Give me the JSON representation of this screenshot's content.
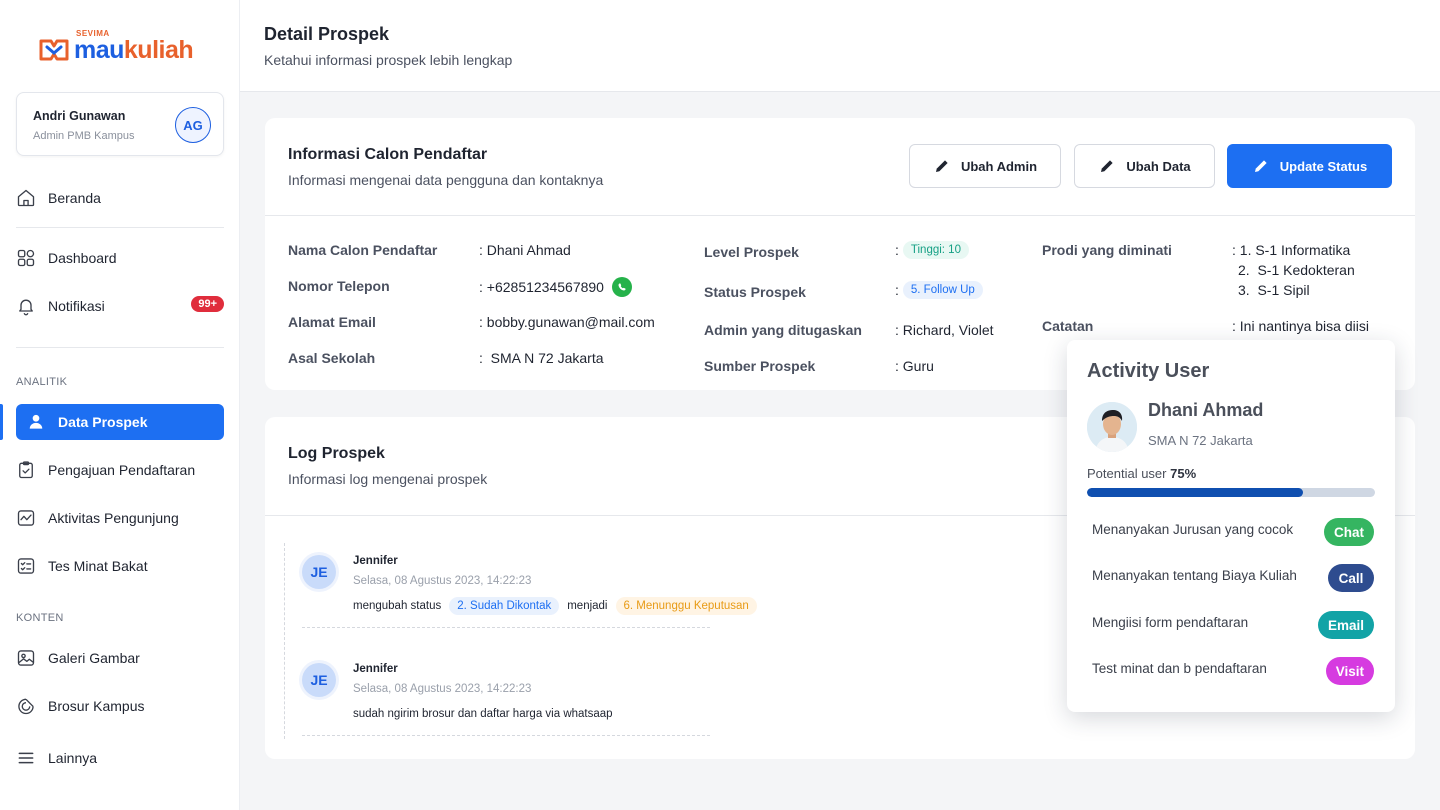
{
  "brand": {
    "small": "SEVIMA",
    "mau": "mau",
    "kuliah": "kuliah"
  },
  "user": {
    "name": "Andri Gunawan",
    "role": "Admin PMB Kampus",
    "initials": "AG"
  },
  "nav": {
    "beranda": "Beranda",
    "dashboard": "Dashboard",
    "notifikasi": "Notifikasi",
    "notif_badge": "99+",
    "section_analitik": "ANALITIK",
    "data_prospek": "Data Prospek",
    "pengajuan": "Pengajuan Pendaftaran",
    "aktivitas": "Aktivitas Pengunjung",
    "tes_minat": "Tes Minat Bakat",
    "section_konten": "KONTEN",
    "galeri": "Galeri Gambar",
    "brosur": "Brosur Kampus",
    "lainnya": "Lainnya"
  },
  "header": {
    "title": "Detail Prospek",
    "subtitle": "Ketahui informasi prospek lebih lengkap"
  },
  "info": {
    "title": "Informasi Calon Pendaftar",
    "subtitle": "Informasi mengenai data pengguna dan kontaknya",
    "btn_ubah_admin": "Ubah Admin",
    "btn_ubah_data": "Ubah Data",
    "btn_update_status": "Update Status",
    "nama_label": "Nama Calon Pendaftar",
    "nama_value": ": Dhani Ahmad",
    "telepon_label": "Nomor Telepon",
    "telepon_value": ": +62851234567890",
    "email_label": "Alamat Email",
    "email_value": ": bobby.gunawan@mail.com",
    "sekolah_label": "Asal Sekolah",
    "sekolah_value": ":  SMA N 72 Jakarta",
    "level_label": "Level Prospek",
    "level_value": "Tinggi: 10",
    "status_label": "Status Prospek",
    "status_value": "5. Follow Up",
    "admin_label": "Admin yang ditugaskan",
    "admin_value": ": Richard, Violet",
    "sumber_label": "Sumber Prospek",
    "sumber_value": ": Guru",
    "prodi_label": "Prodi yang diminati",
    "prodi_1": ": 1. S-1 Informatika",
    "prodi_2": "2.  S-1 Kedokteran",
    "prodi_3": "3.  S-1 Sipil",
    "catatan_label": "Catatan",
    "catatan_value": ": Ini nantinya bisa diisi",
    "colon": ":"
  },
  "log": {
    "title": "Log Prospek",
    "subtitle": "Informasi log mengenai prospek",
    "entries": [
      {
        "initials": "JE",
        "name": "Jennifer",
        "date": "Selasa, 08 Agustus 2023, 14:22:23",
        "prefix": "mengubah status",
        "from": "2. Sudah Dikontak",
        "mid": "menjadi",
        "to": "6. Menunggu Keputusan"
      },
      {
        "initials": "JE",
        "name": "Jennifer",
        "date": "Selasa, 08 Agustus 2023, 14:22:23",
        "message": "sudah ngirim brosur dan daftar harga via whatsaap"
      }
    ]
  },
  "activity": {
    "title": "Activity User",
    "name": "Dhani Ahmad",
    "school": "SMA N 72 Jakarta",
    "potential_label": "Potential user",
    "potential_value": "75%",
    "potential_fraction": 0.75,
    "items": [
      {
        "text": "Menanyakan Jurusan yang cocok",
        "chip": "Chat",
        "color": "#35b561"
      },
      {
        "text": "Menanyakan tentang Biaya Kuliah",
        "chip": "Call",
        "color": "#2e4c8f"
      },
      {
        "text": "Mengiisi form pendaftaran",
        "chip": "Email",
        "color": "#12a3a6"
      },
      {
        "text": "Test minat dan b pendaftaran",
        "chip": "Visit",
        "color": "#d63be0"
      }
    ]
  }
}
